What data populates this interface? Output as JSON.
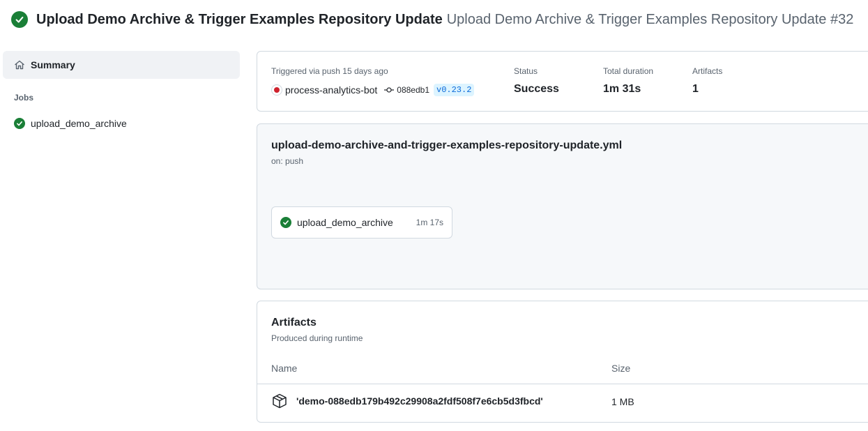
{
  "header": {
    "title": "Upload Demo Archive & Trigger Examples Repository Update",
    "subtitle": "Upload Demo Archive & Trigger Examples Repository Update #32",
    "status_icon": "check-circle-fill-icon",
    "status_color": "#1a7f37"
  },
  "sidebar": {
    "summary_label": "Summary",
    "summary_icon": "home-icon",
    "jobs_heading": "Jobs",
    "jobs": [
      {
        "label": "upload_demo_archive",
        "icon": "check-circle-fill-icon"
      }
    ]
  },
  "run_summary": {
    "trigger_text": "Triggered via push 15 days ago",
    "actor": "process-analytics-bot",
    "commit_sha": "088edb1",
    "tag": "v0.23.2",
    "status_label": "Status",
    "status_value": "Success",
    "duration_label": "Total duration",
    "duration_value": "1m 31s",
    "artifacts_label": "Artifacts",
    "artifacts_value": "1"
  },
  "workflow": {
    "file": "upload-demo-archive-and-trigger-examples-repository-update.yml",
    "trigger": "on: push",
    "job": {
      "label": "upload_demo_archive",
      "duration": "1m 17s"
    }
  },
  "artifacts": {
    "title": "Artifacts",
    "subtitle": "Produced during runtime",
    "columns": [
      "Name",
      "Size"
    ],
    "rows": [
      {
        "name": "'demo-088edb179b492c29908a2fdf508f7e6cb5d3fbcd'",
        "size": "1 MB",
        "icon": "package-icon"
      }
    ]
  },
  "colors": {
    "success": "#1a7f37",
    "accent": "#0969da",
    "tag_bg": "#ddf4ff",
    "border": "#d1d9e0",
    "muted": "#59636e"
  }
}
